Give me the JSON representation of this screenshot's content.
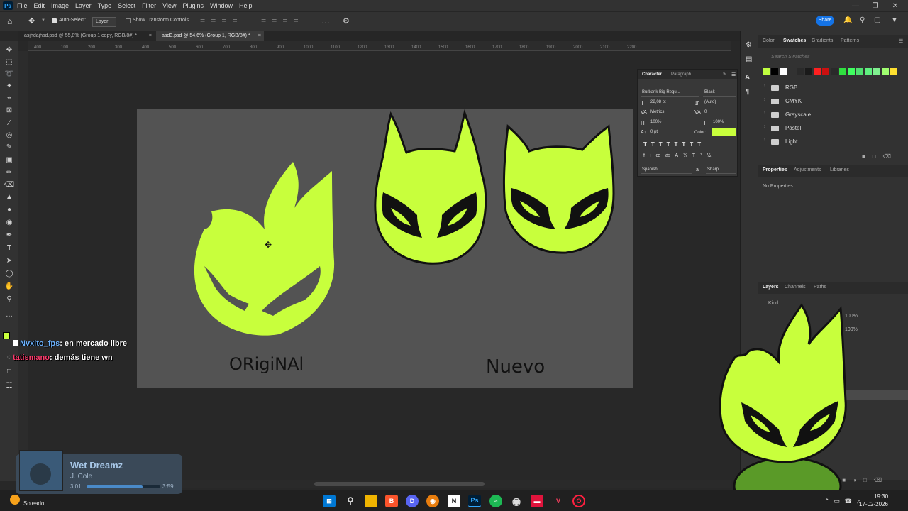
{
  "menubar": {
    "app_icon": "Ps",
    "items": [
      "File",
      "Edit",
      "Image",
      "Layer",
      "Type",
      "Select",
      "Filter",
      "View",
      "Plugins",
      "Window",
      "Help"
    ]
  },
  "options": {
    "auto_select_label": "Auto-Select:",
    "auto_select_value": "Layer",
    "show_transform": "Show Transform Controls",
    "share_label": "Share"
  },
  "tabs": [
    {
      "label": "asjhdajhsd.psd @ 55,8% (Group 1 copy, RGB/8#) *",
      "active": false
    },
    {
      "label": "asd3.psd @ 54,6% (Group 1, RGB/8#) *",
      "active": true
    }
  ],
  "ruler": {
    "marks": [
      "400",
      "100",
      "200",
      "300",
      "400",
      "500",
      "600",
      "700",
      "800",
      "900",
      "1000",
      "1100",
      "1200",
      "1300",
      "1400",
      "1500",
      "1600",
      "1700",
      "1800",
      "1900",
      "2000",
      "2100",
      "2200"
    ]
  },
  "artboard": {
    "label_original": "ORigiNAl",
    "label_new": "Nuevo",
    "colors": {
      "fill": "#c8ff3c",
      "stroke": "#111111",
      "bg": "#535353"
    }
  },
  "right_panel": {
    "swatches_tabs": [
      "Color",
      "Swatches",
      "Gradients",
      "Patterns"
    ],
    "swatches_active": "Swatches",
    "search_placeholder": "Search Swatches",
    "swatch_colors": [
      "#c0ff40",
      "#000000",
      "#ffffff",
      "#2a2a2a",
      "#1a1a1a",
      "#ff2020",
      "#cc1010",
      "#2a2a2a",
      "#30e040",
      "#40ff60",
      "#50e070",
      "#60f080",
      "#80f090",
      "#a0ff70",
      "#b0f060",
      "#ffe030"
    ],
    "folders": [
      "RGB",
      "CMYK",
      "Grayscale",
      "Pastel",
      "Light"
    ],
    "properties_tabs": [
      "Properties",
      "Adjustments",
      "Libraries"
    ],
    "properties_active": "Properties",
    "no_properties": "No Properties",
    "layers_tabs": [
      "Layers",
      "Channels",
      "Paths"
    ],
    "layers_active": "Layers",
    "layers_kind": "Kind",
    "opacity": "100%",
    "fill": "100%"
  },
  "character": {
    "tabs": [
      "Character",
      "Paragraph"
    ],
    "font": "Burbank Big Regu...",
    "style": "Black",
    "size": "22,08 pt",
    "leading": "(Auto)",
    "kerning": "Metrics",
    "tracking": "0",
    "vscale": "100%",
    "hscale": "100%",
    "baseline": "0 pt",
    "color_label": "Color:",
    "color_value": "#c8ff3c",
    "language": "Spanish",
    "aa_label": "a",
    "antialias": "Sharp"
  },
  "chat": [
    {
      "user": "Nvxito_fps",
      "color": "#6db3ff",
      "message": "en mercado libre"
    },
    {
      "user": "tatismano",
      "color": "#ff3c6e",
      "message": "demás tiene wn"
    }
  ],
  "music": {
    "title": "Wet Dreamz",
    "artist": "J. Cole",
    "elapsed": "3:01",
    "duration": "3:59",
    "progress": 0.76
  },
  "taskbar": {
    "weather": "Soleado",
    "time": "19:30",
    "date": "17-02-2026"
  }
}
